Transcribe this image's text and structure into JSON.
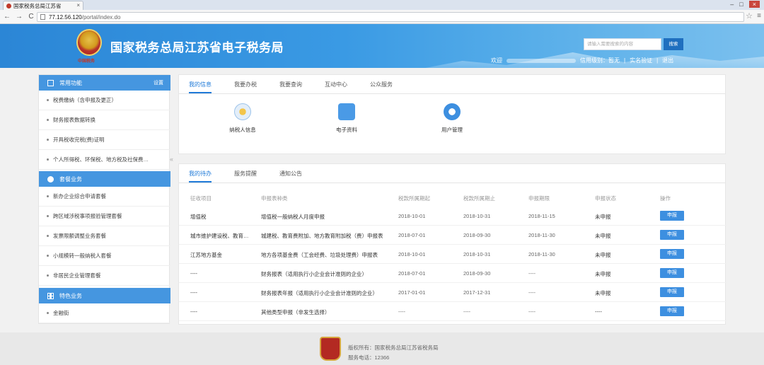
{
  "browser": {
    "tab_title": "国家税务总局江苏省",
    "tab_close": "×",
    "url_host": "77.12.56.120",
    "url_path": "/portal/index.do",
    "win_min": "–",
    "win_max": "□",
    "win_close": "×"
  },
  "header": {
    "emblem_caption": "中国税务",
    "site_title": "国家税务总局江苏省电子税务局",
    "search_placeholder": "请输入需要搜索的内容",
    "search_button": "搜索",
    "welcome": "欢迎",
    "credit": "信用级别：暂无",
    "sep1": "|",
    "realname": "实名验证",
    "sep2": "|",
    "logout": "退出"
  },
  "sidebar": {
    "sections": [
      {
        "title": "常用功能",
        "extra": "设置"
      },
      {
        "title": "套餐业务"
      },
      {
        "title": "特色业务"
      }
    ],
    "common_items": [
      "税费缴纳（含申报及更正）",
      "财务报表数据转换",
      "开具税收完税(费)证明",
      "个人所得税、环保税、地方税及社保费…"
    ],
    "package_items": [
      "新办企业综合申请套餐",
      "跨区域涉税事项报验管理套餐",
      "发票限额调整业务套餐",
      "小规模转一般纳税人套餐",
      "非居民企业管理套餐"
    ],
    "special_items": [
      "金融街"
    ],
    "collapse_glyph": "«"
  },
  "info_panel": {
    "tabs": [
      "我的信息",
      "我要办税",
      "我要查询",
      "互动中心",
      "公众服务"
    ],
    "apps": [
      "纳税人信息",
      "电子资料",
      "用户管理"
    ]
  },
  "todo_panel": {
    "tabs": [
      "我的待办",
      "服务提醒",
      "通知公告"
    ],
    "columns": [
      "征收项目",
      "申报表种类",
      "税款所属期起",
      "税款所属期止",
      "申报期限",
      "申报状态",
      "操作"
    ],
    "rows": [
      [
        "增值税",
        "增值税一般纳税人月度申报",
        "2018-10-01",
        "2018-10-31",
        "2018-11-15",
        "未申报",
        "申报"
      ],
      [
        "城市维护建设税、教育…",
        "城建税、教育费附加、地方教育附加税（费）申报表",
        "2018-07-01",
        "2018-09-30",
        "2018-11-30",
        "未申报",
        "申报"
      ],
      [
        "江苏地方基金",
        "地方各项基金费（工会经费、垃圾处理费）申报表",
        "2018-10-01",
        "2018-10-31",
        "2018-11-30",
        "未申报",
        "申报"
      ],
      [
        "----",
        "财务报表（适用执行小企业会计准则的企业）",
        "2018-07-01",
        "2018-09-30",
        "----",
        "未申报",
        "申报"
      ],
      [
        "----",
        "财务报表年报（适用执行小企业会计准则的企业）",
        "2017-01-01",
        "2017-12-31",
        "----",
        "未申报",
        "申报"
      ],
      [
        "----",
        "其他类型申报（非发生选择）",
        "----",
        "----",
        "----",
        "----",
        "申报"
      ]
    ]
  },
  "footer": {
    "copyright": "版权所有：国家税务总局江苏省税务局",
    "hotline": "服务电话：12366"
  },
  "colors": {
    "accent": "#1f7ad8",
    "sidebar_header": "#4596e0",
    "button": "#3d8fe0"
  },
  "icons": [
    "favicon-icon",
    "back-icon",
    "forward-icon",
    "reload-icon",
    "star-icon",
    "menu-icon",
    "emblem-icon",
    "star-outline-icon",
    "bundle-icon",
    "grid-icon",
    "taxpayer-info-icon",
    "folder-icon",
    "gear-icon"
  ]
}
